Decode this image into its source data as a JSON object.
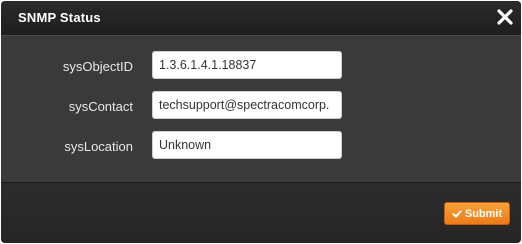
{
  "dialog": {
    "title": "SNMP Status",
    "close_icon": "close-icon"
  },
  "fields": [
    {
      "label": "sysObjectID",
      "value": "1.3.6.1.4.1.18837"
    },
    {
      "label": "sysContact",
      "value": "techsupport@spectracomcorp."
    },
    {
      "label": "sysLocation",
      "value": "Unknown"
    }
  ],
  "footer": {
    "submit_label": "Submit",
    "submit_icon": "checkmark-icon"
  },
  "colors": {
    "title_bar": "#1f1f1f",
    "body": "#3a3a3a",
    "accent": "#f0861f"
  }
}
